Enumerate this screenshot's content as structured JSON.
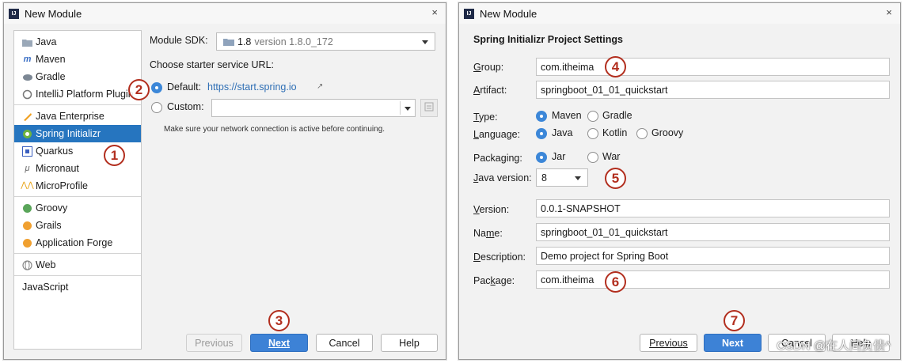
{
  "left_dialog": {
    "title": "New Module",
    "close": "×",
    "sidebar": [
      {
        "label": "Java",
        "icon": "folder-icon"
      },
      {
        "label": "Maven",
        "icon": "maven-icon"
      },
      {
        "label": "Gradle",
        "icon": "gradle-icon"
      },
      {
        "label": "IntelliJ Platform Plugin",
        "icon": "plugin-icon"
      },
      {
        "label": "Java Enterprise",
        "icon": "java-enterprise-icon"
      },
      {
        "label": "Spring Initializr",
        "icon": "spring-icon",
        "selected": true
      },
      {
        "label": "Quarkus",
        "icon": "quarkus-icon"
      },
      {
        "label": "Micronaut",
        "icon": "micronaut-icon"
      },
      {
        "label": "MicroProfile",
        "icon": "microprofile-icon"
      },
      {
        "label": "Groovy",
        "icon": "groovy-icon"
      },
      {
        "label": "Grails",
        "icon": "grails-icon"
      },
      {
        "label": "Application Forge",
        "icon": "forge-icon"
      },
      {
        "label": "Web",
        "icon": "globe-icon"
      },
      {
        "label": "JavaScript",
        "icon": ""
      }
    ],
    "module_sdk_label": "Module SDK:",
    "module_sdk_value": "1.8",
    "module_sdk_version": "version 1.8.0_172",
    "starter_url_label": "Choose starter service URL:",
    "default_label": "Default:",
    "default_url": "https://start.spring.io",
    "link_arrow": "↗",
    "custom_label": "Custom:",
    "custom_value": "",
    "network_hint": "Make sure your network connection is active before continuing.",
    "buttons": {
      "previous": "Previous",
      "next": "Next",
      "cancel": "Cancel",
      "help": "Help"
    }
  },
  "right_dialog": {
    "title": "New Module",
    "close": "×",
    "section_title": "Spring Initializr Project Settings",
    "group_label": "Group:",
    "group_value": "com.itheima",
    "artifact_label": "Artifact:",
    "artifact_value": "springboot_01_01_quickstart",
    "type_label": "Type:",
    "type_options": [
      "Maven",
      "Gradle"
    ],
    "type_selected": "Maven",
    "language_label": "Language:",
    "language_options": [
      "Java",
      "Kotlin",
      "Groovy"
    ],
    "language_selected": "Java",
    "packaging_label": "Packaging:",
    "packaging_options": [
      "Jar",
      "War"
    ],
    "packaging_selected": "Jar",
    "java_version_label": "Java version:",
    "java_version_value": "8",
    "version_label": "Version:",
    "version_value": "0.0.1-SNAPSHOT",
    "name_label": "Name:",
    "name_value": "springboot_01_01_quickstart",
    "description_label": "Description:",
    "description_value": "Demo project for Spring Boot",
    "package_label": "Package:",
    "package_value": "com.itheima",
    "buttons": {
      "previous": "Previous",
      "next": "Next",
      "cancel": "Cancel",
      "help": "Help"
    }
  },
  "callouts": [
    "1",
    "2",
    "3",
    "4",
    "5",
    "6",
    "7"
  ],
  "watermark": "CSDN @在人间负债^",
  "colors": {
    "accent": "#3d82d6",
    "selection": "#2675bf",
    "callout": "#b22e1e",
    "link": "#2f6fb5"
  }
}
